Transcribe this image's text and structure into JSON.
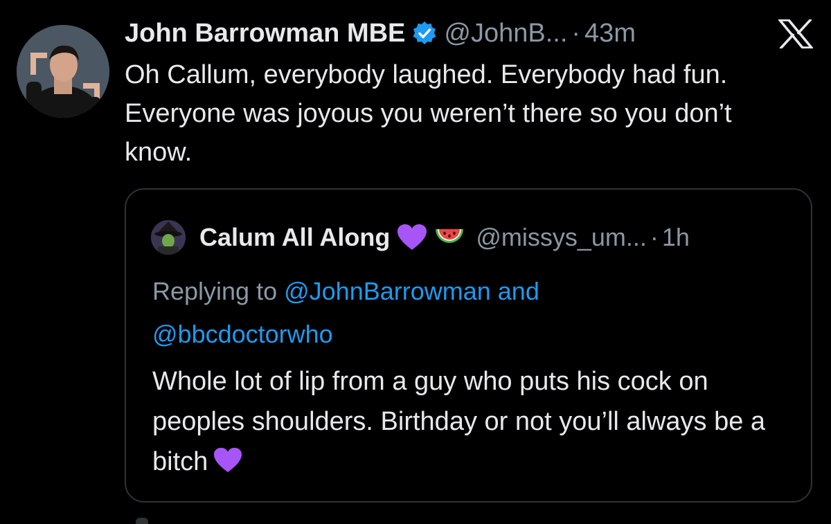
{
  "tweet": {
    "author_name": "John Barrowman MBE",
    "handle": "@JohnB...",
    "separator": "·",
    "time": "43m",
    "verified": true,
    "text": "Oh Callum, everybody laughed. Everybody had fun. Everyone was joyous you weren’t there so you don’t know.",
    "avatar_icon": "profile-photo-framing-hands",
    "logo_icon": "x-logo-icon"
  },
  "quoted_tweet": {
    "author_name": "Calum All Along",
    "name_emojis": [
      "purple-heart-icon",
      "watermelon-icon"
    ],
    "handle": "@missys_um...",
    "separator": "·",
    "time": "1h",
    "replying_prefix": "Replying to ",
    "mention_1": "@JohnBarrowman",
    "and_word": " and",
    "mention_2": "@bbcdoctorwho",
    "text": "Whole lot of lip from a guy who puts his cock on peoples shoulders. Birthday or not you’ll always be a bitch",
    "trailing_emoji": "purple-heart-icon"
  },
  "colors": {
    "background": "#000000",
    "primary_text": "#e7e9ea",
    "secondary_text": "#8b98a5",
    "link": "#1d9bf0",
    "verified_badge": "#1d9bf0",
    "card_border": "#2f3336",
    "emoji_purple": "#a855f7"
  }
}
